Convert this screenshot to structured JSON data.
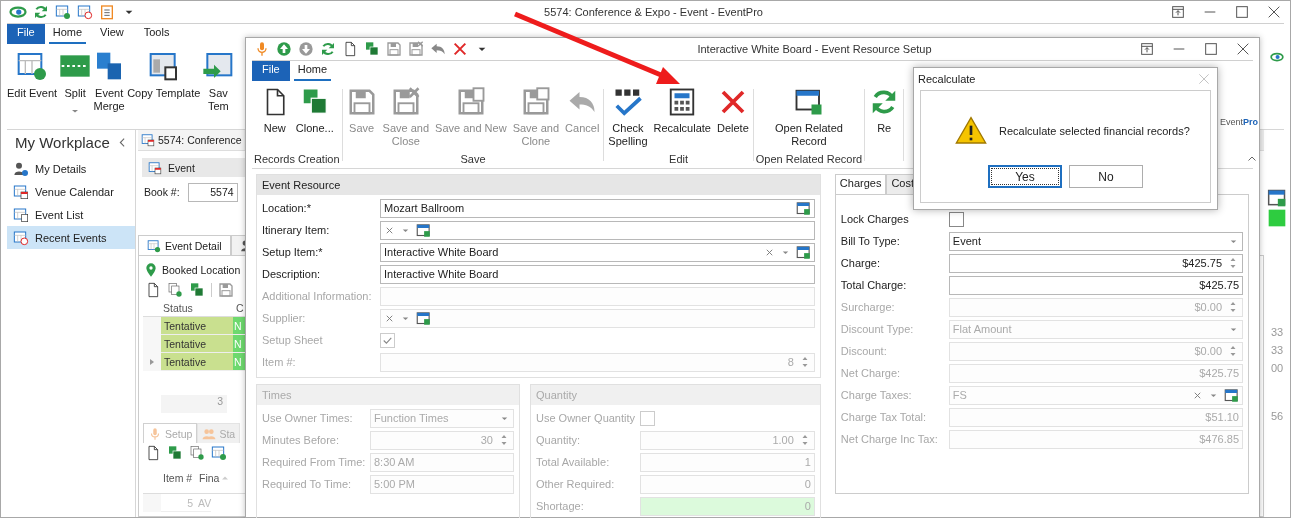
{
  "main_window": {
    "title": "5574: Conference & Expo - Event - EventPro",
    "tabs": [
      {
        "label": "File",
        "kind": "file",
        "selected": false
      },
      {
        "label": "Home",
        "kind": "tab",
        "selected": true
      },
      {
        "label": "View",
        "kind": "tab",
        "selected": false
      },
      {
        "label": "Tools",
        "kind": "tab",
        "selected": false
      }
    ],
    "ribbon": [
      {
        "lines": [
          "Edit Event"
        ],
        "dropdown": false
      },
      {
        "lines": [
          "Split"
        ],
        "dropdown": true
      },
      {
        "lines": [
          "Event",
          "Merge"
        ],
        "dropdown": false
      },
      {
        "lines": [
          "Copy Template"
        ],
        "dropdown": false
      },
      {
        "lines": [
          "Sav",
          "Tem"
        ],
        "dropdown": false
      }
    ],
    "sidebar": {
      "title": "My Workplace",
      "items": [
        {
          "label": "My Details",
          "selected": false
        },
        {
          "label": "Venue Calendar",
          "selected": false
        },
        {
          "label": "Event List",
          "selected": false
        },
        {
          "label": "Recent Events",
          "selected": true
        }
      ]
    },
    "document_tab": "5574: Conference",
    "event_panel": {
      "title": "Event",
      "book_label": "Book #:",
      "book_value": "5574"
    },
    "detail_tab": {
      "label": "Event Detail",
      "selected": true
    },
    "booked_locations": {
      "title": "Booked Location",
      "columns": [
        "Status",
        "C"
      ],
      "rows": [
        {
          "status": "Tentative",
          "column_2": "N",
          "current": false
        },
        {
          "status": "Tentative",
          "column_2": "N",
          "current": false
        },
        {
          "status": "Tentative",
          "column_2": "N",
          "current": true
        }
      ],
      "count": "3"
    },
    "setup_tabs": [
      {
        "label": "Setup",
        "selected": true
      },
      {
        "label": "Sta",
        "selected": false
      }
    ],
    "setup_grid": {
      "columns": [
        "Item #",
        "Fina"
      ],
      "rows": [
        {
          "item": "5",
          "column_2": "AV"
        }
      ]
    },
    "right_edge": [
      "33",
      "33",
      "00",
      "56"
    ]
  },
  "dialog": {
    "title": "Interactive White Board - Event Resource Setup",
    "tabs": [
      {
        "label": "File",
        "kind": "file",
        "selected": false
      },
      {
        "label": "Home",
        "kind": "tab",
        "selected": true
      }
    ],
    "ribbon_groups": [
      {
        "title": "Records Creation",
        "buttons": [
          {
            "lines": [
              "New"
            ],
            "disabled": false
          },
          {
            "lines": [
              "Clone..."
            ],
            "disabled": false
          }
        ]
      },
      {
        "title": "Save",
        "buttons": [
          {
            "lines": [
              "Save"
            ],
            "disabled": true
          },
          {
            "lines": [
              "Save and",
              "Close"
            ],
            "disabled": true
          },
          {
            "lines": [
              "Save and New"
            ],
            "disabled": true
          },
          {
            "lines": [
              "Save and",
              "Clone"
            ],
            "disabled": true
          },
          {
            "lines": [
              "Cancel"
            ],
            "disabled": true
          }
        ]
      },
      {
        "title": "Edit",
        "buttons": [
          {
            "lines": [
              "Check",
              "Spelling"
            ],
            "disabled": false
          },
          {
            "lines": [
              "Recalculate"
            ],
            "disabled": false
          },
          {
            "lines": [
              "Delete"
            ],
            "disabled": false
          }
        ]
      },
      {
        "title": "Open Related Record",
        "buttons": [
          {
            "lines": [
              "Open Related",
              "Record"
            ],
            "disabled": false
          }
        ]
      },
      {
        "buttons": [
          {
            "lines": [
              "Re"
            ]
          }
        ]
      }
    ],
    "logo": "Event**Pro**",
    "event_resource": {
      "title": "Event Resource",
      "fields": [
        {
          "label": "Location:*",
          "kind": "lookup",
          "value": "Mozart Ballroom",
          "disabled": false
        },
        {
          "label": "Itinerary Item:",
          "kind": "combo",
          "disabled": false
        },
        {
          "label": "Setup Item:*",
          "kind": "combo",
          "value": "Interactive White Board",
          "disabled": false
        },
        {
          "label": "Description:",
          "kind": "text",
          "value": "Interactive White Board",
          "disabled": false
        },
        {
          "label": "Additional Information:",
          "kind": "text",
          "disabled": true
        },
        {
          "label": "Supplier:",
          "kind": "combo",
          "disabled": true
        },
        {
          "label": "Setup Sheet",
          "kind": "checkbox",
          "checked": true,
          "disabled": true
        },
        {
          "label": "Item #:",
          "kind": "spin",
          "value": "8",
          "disabled": true
        }
      ]
    },
    "times": {
      "title": "Times",
      "fields": [
        {
          "label": "Use Owner Times:",
          "kind": "dropdown",
          "value": "Function Times",
          "disabled": true
        },
        {
          "label": "Minutes Before:",
          "kind": "spin",
          "value": "30",
          "disabled": true
        },
        {
          "label": "Required From Time:",
          "kind": "text",
          "value": "8:30 AM",
          "disabled": true
        },
        {
          "label": "Required To Time:",
          "kind": "text",
          "value": "5:00 PM",
          "disabled": true
        }
      ]
    },
    "quantity": {
      "title": "Quantity",
      "fields": [
        {
          "label": "Use Owner Quantity",
          "kind": "checkbox",
          "checked": false,
          "disabled": true
        },
        {
          "label": "Quantity:",
          "kind": "spin",
          "value": "1.00",
          "disabled": true
        },
        {
          "label": "Total Available:",
          "kind": "number",
          "value": "1",
          "disabled": true
        },
        {
          "label": "Other Required:",
          "kind": "number",
          "value": "0",
          "disabled": true
        },
        {
          "label": "Shortage:",
          "kind": "number",
          "value": "0",
          "disabled": true,
          "highlight": true
        }
      ]
    },
    "charges": {
      "tabs": [
        {
          "label": "Charges",
          "selected": true
        },
        {
          "label": "Cost",
          "selected": false
        }
      ],
      "fields": [
        {
          "label": "Lock Charges",
          "kind": "checkbox",
          "checked": false,
          "disabled": false
        },
        {
          "label": "Bill To Type:",
          "kind": "dropdown",
          "value": "Event",
          "disabled": false
        },
        {
          "label": "Charge:",
          "kind": "spin",
          "value": "$425.75",
          "disabled": false
        },
        {
          "label": "Total Charge:",
          "kind": "number",
          "value": "$425.75",
          "disabled": false
        },
        {
          "label": "Surcharge:",
          "kind": "spin",
          "value": "$0.00",
          "disabled": true
        },
        {
          "label": "Discount Type:",
          "kind": "dropdown",
          "value": "Flat Amount",
          "disabled": true
        },
        {
          "label": "Discount:",
          "kind": "spin",
          "value": "$0.00",
          "disabled": true
        },
        {
          "label": "Net Charge:",
          "kind": "number",
          "value": "$425.75",
          "disabled": true
        },
        {
          "label": "Charge Taxes:",
          "kind": "combo",
          "value": "FS",
          "disabled": true
        },
        {
          "label": "Charge Tax Total:",
          "kind": "number",
          "value": "$51.10",
          "disabled": true
        },
        {
          "label": "Net Charge Inc Tax:",
          "kind": "number",
          "value": "$476.85",
          "disabled": true
        }
      ]
    }
  },
  "message_box": {
    "title": "Recalculate",
    "message": "Recalculate selected financial records?",
    "buttons": [
      {
        "label": "Yes",
        "selected": true
      },
      {
        "label": "No",
        "selected": false
      }
    ]
  }
}
